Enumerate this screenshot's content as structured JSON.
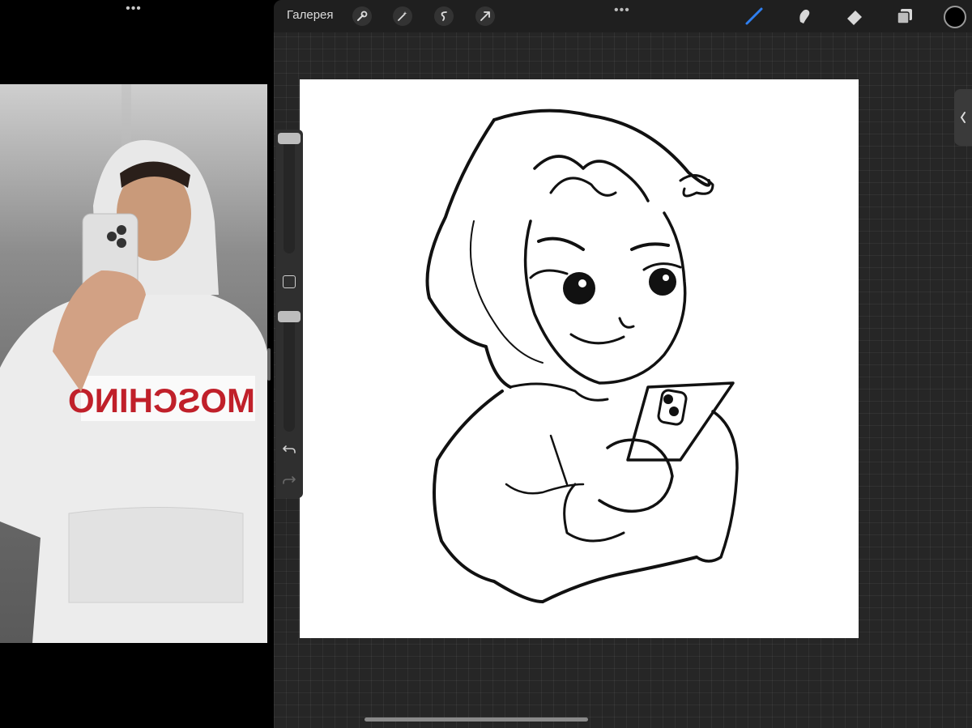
{
  "left_pane": {
    "dots": "•••",
    "photo": {
      "sweatshirt_text": "MOSCHINO"
    }
  },
  "procreate": {
    "topbar": {
      "gallery_label": "Галерея",
      "left_tools": [
        "wrench-icon",
        "magic-wand-icon",
        "selection-icon",
        "transform-arrow-icon"
      ],
      "dots": "•••",
      "right_tools": [
        "brush-icon",
        "smudge-icon",
        "eraser-icon",
        "layers-icon"
      ],
      "active_tool": "brush-icon",
      "current_color": "#000000"
    },
    "sidebar": {
      "brush_size_level": 0.98,
      "opacity_level": 0.98
    },
    "colors": {
      "accent": "#2f7ff0",
      "canvas": "#ffffff",
      "workspace": "#262626",
      "toolbar": "#1f1f1f"
    }
  }
}
